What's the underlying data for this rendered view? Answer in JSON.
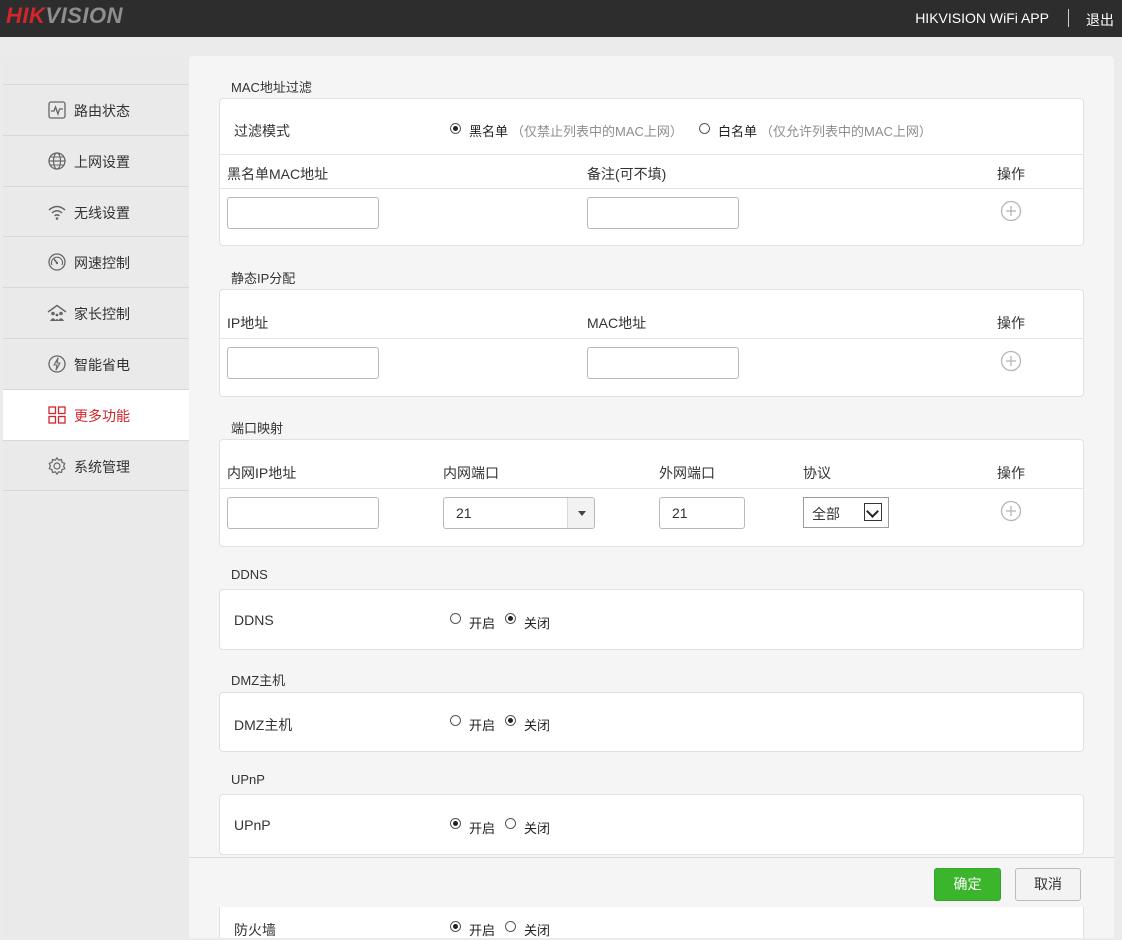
{
  "header": {
    "logo_left": "HIK",
    "logo_right": "VISION",
    "app_name": "HIKVISION WiFi APP",
    "logout_label": "退出"
  },
  "sidebar": {
    "items": [
      {
        "label": "路由状态",
        "icon": "router-status-icon",
        "active": false
      },
      {
        "label": "上网设置",
        "icon": "globe-icon",
        "active": false
      },
      {
        "label": "无线设置",
        "icon": "wifi-icon",
        "active": false
      },
      {
        "label": "网速控制",
        "icon": "speedometer-icon",
        "active": false
      },
      {
        "label": "家长控制",
        "icon": "family-icon",
        "active": false
      },
      {
        "label": "智能省电",
        "icon": "power-save-icon",
        "active": false
      },
      {
        "label": "更多功能",
        "icon": "grid-icon",
        "active": true
      },
      {
        "label": "系统管理",
        "icon": "gear-icon",
        "active": false
      }
    ]
  },
  "mac_filter": {
    "title": "MAC地址过滤",
    "mode_label": "过滤模式",
    "blacklist_label": "黑名单",
    "blacklist_hint": "（仅禁止列表中的MAC上网）",
    "whitelist_label": "白名单",
    "whitelist_hint": "（仅允许列表中的MAC上网）",
    "selected_mode": "黑名单",
    "col_mac": "黑名单MAC地址",
    "col_note": "备注(可不填)",
    "col_action": "操作",
    "mac_value": "",
    "note_value": ""
  },
  "static_ip": {
    "title": "静态IP分配",
    "col_ip": "IP地址",
    "col_mac": "MAC地址",
    "col_action": "操作",
    "ip_value": "",
    "mac_value": ""
  },
  "port_mapping": {
    "title": "端口映射",
    "col_lan_ip": "内网IP地址",
    "col_lan_port": "内网端口",
    "col_wan_port": "外网端口",
    "col_protocol": "协议",
    "col_action": "操作",
    "lan_ip_value": "",
    "lan_port_value": "21",
    "wan_port_value": "21",
    "protocol_value": "全部"
  },
  "ddns": {
    "title": "DDNS",
    "label": "DDNS",
    "on_label": "开启",
    "off_label": "关闭",
    "state": "关闭"
  },
  "dmz": {
    "title": "DMZ主机",
    "label": "DMZ主机",
    "on_label": "开启",
    "off_label": "关闭",
    "state": "关闭"
  },
  "upnp": {
    "title": "UPnP",
    "label": "UPnP",
    "on_label": "开启",
    "off_label": "关闭",
    "state": "开启"
  },
  "firewall": {
    "label": "防火墙",
    "on_label": "开启",
    "off_label": "关闭",
    "state": "开启"
  },
  "footer": {
    "ok_label": "确定",
    "cancel_label": "取消"
  },
  "colors": {
    "brand_red": "#d3252c",
    "topbar_bg": "#2d2d2d",
    "confirm_green": "#3bb52b"
  }
}
